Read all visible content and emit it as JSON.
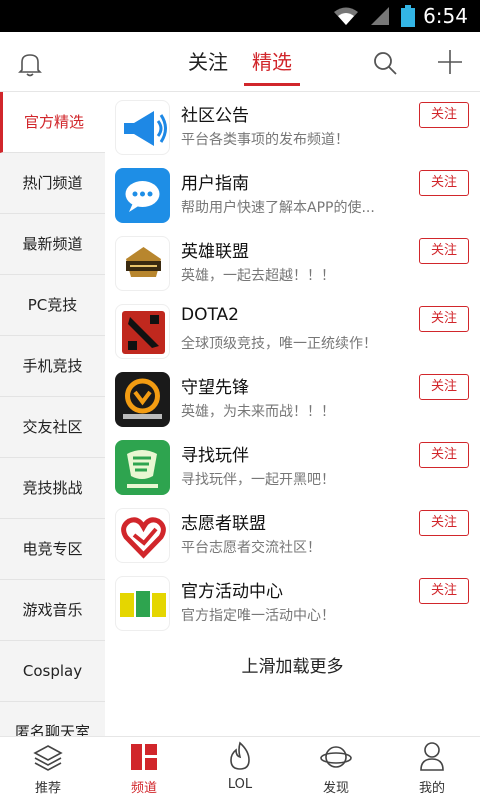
{
  "status": {
    "time": "6:54"
  },
  "header": {
    "tabs": [
      "关注",
      "精选"
    ]
  },
  "sidebar": {
    "items": [
      "官方精选",
      "热门频道",
      "最新频道",
      "PC竞技",
      "手机竞技",
      "交友社区",
      "竞技挑战",
      "电竞专区",
      "游戏音乐",
      "Cosplay",
      "匿名聊天室"
    ]
  },
  "channels": [
    {
      "title": "社区公告",
      "desc": "平台各类事项的发布频道！",
      "follow": "关注",
      "icon": "megaphone-icon"
    },
    {
      "title": "用户指南",
      "desc": "帮助用户快速了解本APP的使...",
      "follow": "关注",
      "icon": "chat-bubble-icon"
    },
    {
      "title": "英雄联盟",
      "desc": "英雄，一起去超越！！！",
      "follow": "关注",
      "icon": "league-of-legends-logo"
    },
    {
      "title": "DOTA2",
      "desc": "全球顶级竞技，唯一正统续作！",
      "follow": "关注",
      "icon": "dota2-logo"
    },
    {
      "title": "守望先锋",
      "desc": "英雄，为未来而战！！！",
      "follow": "关注",
      "icon": "overwatch-logo"
    },
    {
      "title": "寻找玩伴",
      "desc": "寻找玩伴，一起开黑吧！",
      "follow": "关注",
      "icon": "find-partner-logo"
    },
    {
      "title": "志愿者联盟",
      "desc": "平台志愿者交流社区！",
      "follow": "关注",
      "icon": "volunteer-heart-logo"
    },
    {
      "title": "官方活动中心",
      "desc": "官方指定唯一活动中心！",
      "follow": "关注",
      "icon": "activity-zone-logo"
    }
  ],
  "load_more": "上滑加载更多",
  "bottom_nav": [
    "推荐",
    "频道",
    "LOL",
    "发现",
    "我的"
  ],
  "colors": {
    "accent": "#d1262b"
  }
}
